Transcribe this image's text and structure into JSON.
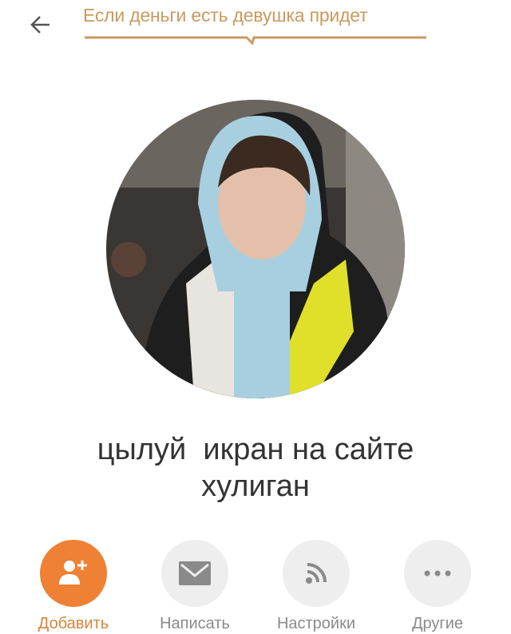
{
  "header": {
    "status_text": "Если деньги есть девушка придет"
  },
  "profile": {
    "name_line1": "цылуй  икран на сайте",
    "name_line2": "хулиган"
  },
  "actions": [
    {
      "label": "Добавить",
      "icon": "add-friend-icon"
    },
    {
      "label": "Написать",
      "icon": "envelope-icon"
    },
    {
      "label": "Настройки",
      "icon": "feed-icon"
    },
    {
      "label": "Другие",
      "icon": "more-icon"
    }
  ],
  "colors": {
    "accent": "#ee8133",
    "status": "#c99a5f",
    "icon_bg": "#eeeeee"
  }
}
